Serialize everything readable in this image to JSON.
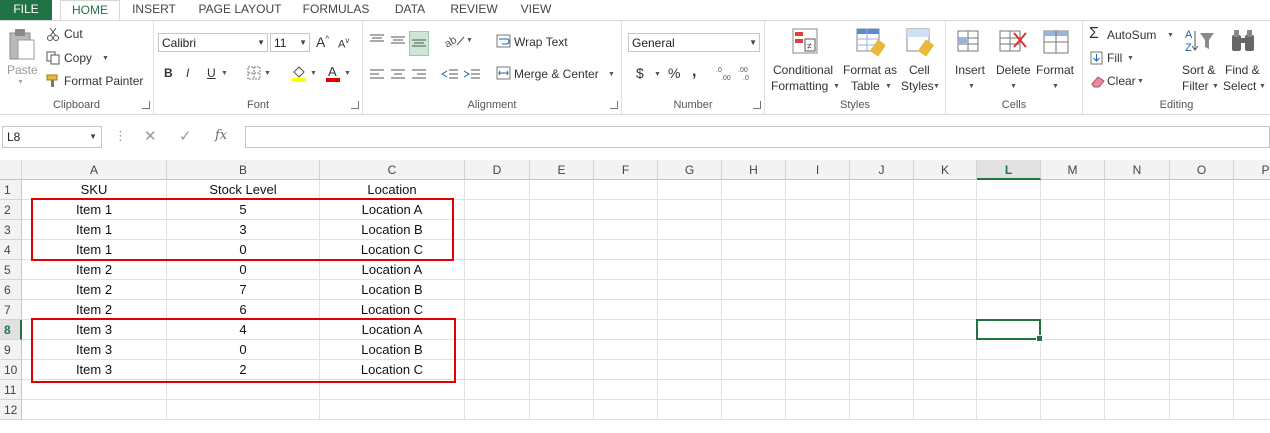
{
  "tabs": [
    "FILE",
    "HOME",
    "INSERT",
    "PAGE LAYOUT",
    "FORMULAS",
    "DATA",
    "REVIEW",
    "VIEW"
  ],
  "clipboard": {
    "paste": "Paste",
    "cut": "Cut",
    "copy": "Copy",
    "format_painter": "Format Painter",
    "label": "Clipboard"
  },
  "font": {
    "name": "Calibri",
    "size": "11",
    "bold": "B",
    "italic": "I",
    "underline": "U",
    "label": "Font"
  },
  "alignment": {
    "wrap_text": "Wrap Text",
    "merge_center": "Merge & Center",
    "label": "Alignment"
  },
  "number": {
    "format": "General",
    "currency": "$",
    "percent": "%",
    "comma": ",",
    "label": "Number"
  },
  "styles": {
    "conditional_1": "Conditional",
    "conditional_2": "Formatting",
    "format_as_1": "Format as",
    "format_as_2": "Table",
    "cell_styles_1": "Cell",
    "cell_styles_2": "Styles",
    "label": "Styles"
  },
  "cells": {
    "insert": "Insert",
    "delete": "Delete",
    "format": "Format",
    "label": "Cells"
  },
  "editing": {
    "autosum": "AutoSum",
    "fill": "Fill",
    "clear": "Clear",
    "sort_1": "Sort &",
    "sort_2": "Filter",
    "find_1": "Find &",
    "find_2": "Select",
    "label": "Editing"
  },
  "formula_bar": {
    "name_box": "L8",
    "fx": "fx",
    "value": ""
  },
  "columns": [
    "A",
    "B",
    "C",
    "D",
    "E",
    "F",
    "G",
    "H",
    "I",
    "J",
    "K",
    "L",
    "M",
    "N",
    "O",
    "P"
  ],
  "selected_column": "L",
  "selected_row": "8",
  "rows": [
    {
      "num": "1",
      "a": "SKU",
      "b": "Stock Level",
      "c": "Location"
    },
    {
      "num": "2",
      "a": "Item 1",
      "b": "5",
      "c": "Location A"
    },
    {
      "num": "3",
      "a": "Item 1",
      "b": "3",
      "c": "Location B"
    },
    {
      "num": "4",
      "a": "Item 1",
      "b": "0",
      "c": "Location C"
    },
    {
      "num": "5",
      "a": "Item 2",
      "b": "0",
      "c": "Location A"
    },
    {
      "num": "6",
      "a": "Item 2",
      "b": "7",
      "c": "Location B"
    },
    {
      "num": "7",
      "a": "Item 2",
      "b": "6",
      "c": "Location C"
    },
    {
      "num": "8",
      "a": "Item 3",
      "b": "4",
      "c": "Location A"
    },
    {
      "num": "9",
      "a": "Item 3",
      "b": "0",
      "c": "Location B"
    },
    {
      "num": "10",
      "a": "Item 3",
      "b": "2",
      "c": "Location C"
    },
    {
      "num": "11",
      "a": "",
      "b": "",
      "c": ""
    },
    {
      "num": "12",
      "a": "",
      "b": "",
      "c": ""
    }
  ],
  "colors": {
    "excel_green": "#217346",
    "highlight_red": "#e00000"
  }
}
